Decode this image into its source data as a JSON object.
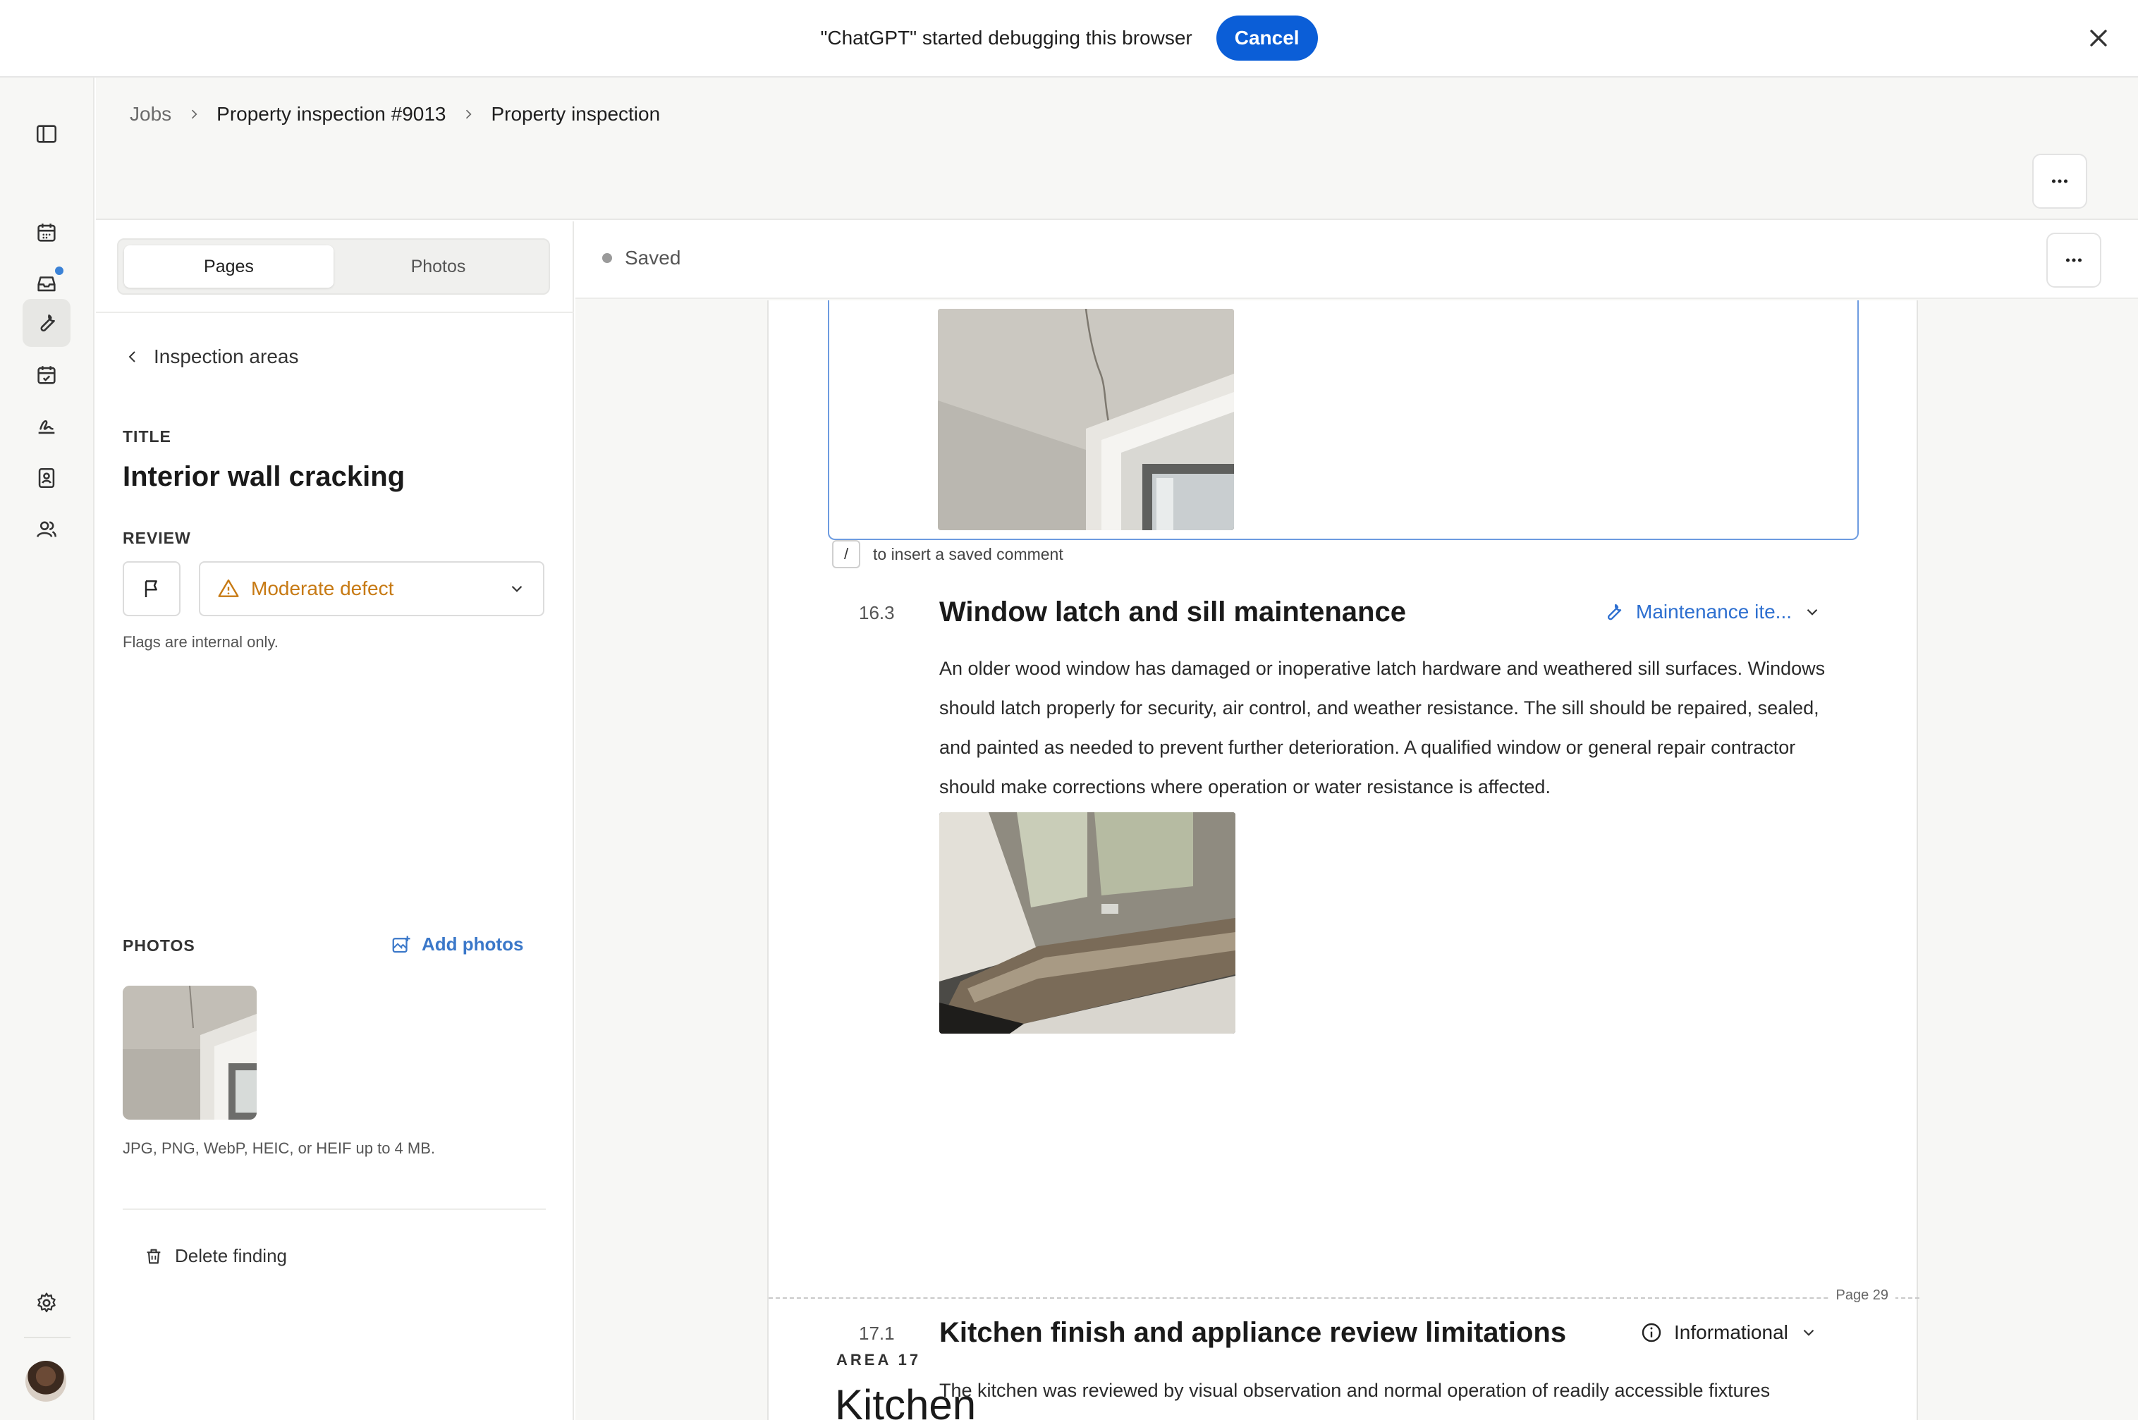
{
  "debug_bar": {
    "message": "\"ChatGPT\" started debugging this browser",
    "cancel_label": "Cancel"
  },
  "rail": {
    "items": [
      "sidebar-toggle-icon",
      "calendar-icon",
      "inbox-icon",
      "wrench-icon",
      "calendar-check-icon",
      "signature-icon",
      "contacts-icon",
      "users-icon"
    ],
    "bottom": [
      "settings-icon",
      "avatar"
    ],
    "active_item": "wrench-icon",
    "notification_item": "inbox-icon"
  },
  "breadcrumb": {
    "items": [
      "Jobs",
      "Property inspection #9013",
      "Property inspection"
    ]
  },
  "panel": {
    "tabs": [
      {
        "label": "Pages",
        "active": true
      },
      {
        "label": "Photos",
        "active": false
      }
    ],
    "back_label": "Inspection areas",
    "title_label": "TITLE",
    "finding_title": "Interior wall cracking",
    "review_label": "REVIEW",
    "review_value": "Moderate defect",
    "flags_hint": "Flags are internal only.",
    "photos_label": "PHOTOS",
    "add_photos_label": "Add photos",
    "file_hint": "JPG, PNG, WebP, HEIC, or HEIF up to 4 MB.",
    "delete_label": "Delete finding"
  },
  "doc": {
    "status": "Saved",
    "slash_key": "/",
    "slash_hint": "to insert a saved comment",
    "findings": [
      {
        "number": "16.3",
        "title": "Window latch and sill maintenance",
        "badge": "Maintenance ite...",
        "text": "An older wood window has damaged or inoperative latch hardware and weathered sill surfaces. Windows should latch properly for security, air control, and weather resistance. The sill should be repaired, sealed, and painted as needed to prevent further deterioration. A qualified window or general repair contractor should make corrections where operation or water resistance is affected."
      },
      {
        "number": "17.1",
        "title": "Kitchen finish and appliance review limitations",
        "badge": "Informational",
        "text": "The kitchen was reviewed by visual observation and normal operation of readily accessible fixtures"
      }
    ],
    "page_label": "Page 29",
    "area_label": "AREA 17",
    "area_title": "Kitchen"
  },
  "colors": {
    "accent": "#0b5ed7",
    "link": "#2d6fd0",
    "warning": "#c77a14",
    "selection_border": "#6d9be0"
  }
}
